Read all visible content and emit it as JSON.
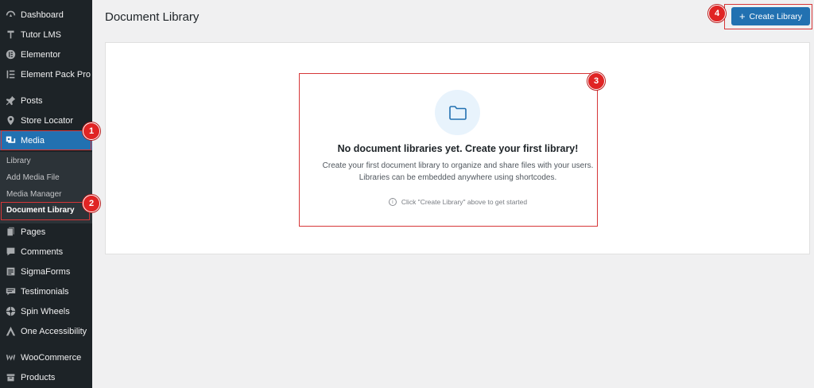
{
  "sidebar": {
    "items": [
      {
        "label": "Dashboard",
        "icon": "dashboard-icon"
      },
      {
        "label": "Tutor LMS",
        "icon": "tutor-icon"
      },
      {
        "label": "Elementor",
        "icon": "elementor-icon"
      },
      {
        "label": "Element Pack Pro",
        "icon": "element-pack-icon"
      },
      {
        "label": "Posts",
        "icon": "pin-icon"
      },
      {
        "label": "Store Locator",
        "icon": "location-icon"
      },
      {
        "label": "Media",
        "icon": "media-icon"
      },
      {
        "label": "Pages",
        "icon": "pages-icon"
      },
      {
        "label": "Comments",
        "icon": "comments-icon"
      },
      {
        "label": "SigmaForms",
        "icon": "forms-icon"
      },
      {
        "label": "Testimonials",
        "icon": "testimonials-icon"
      },
      {
        "label": "Spin Wheels",
        "icon": "wheel-icon"
      },
      {
        "label": "One Accessibility",
        "icon": "accessibility-icon"
      },
      {
        "label": "WooCommerce",
        "icon": "woocommerce-icon"
      },
      {
        "label": "Products",
        "icon": "products-icon"
      }
    ],
    "media_submenu": [
      "Library",
      "Add Media File",
      "Media Manager",
      "Document Library"
    ]
  },
  "header": {
    "title": "Document Library",
    "create_button": "Create Library",
    "create_icon": "+"
  },
  "empty_state": {
    "icon": "folder-icon",
    "title": "No document libraries yet. Create your first library!",
    "description": "Create your first document library to organize and share files with your users. Libraries can be embedded anywhere using shortcodes.",
    "hint": "Click \"Create Library\" above to get started",
    "hint_icon": "i"
  },
  "annotations": [
    "1",
    "2",
    "3",
    "4"
  ],
  "colors": {
    "accent": "#2271b1",
    "sidebar": "#1d2327",
    "annotation": "#e02424"
  }
}
